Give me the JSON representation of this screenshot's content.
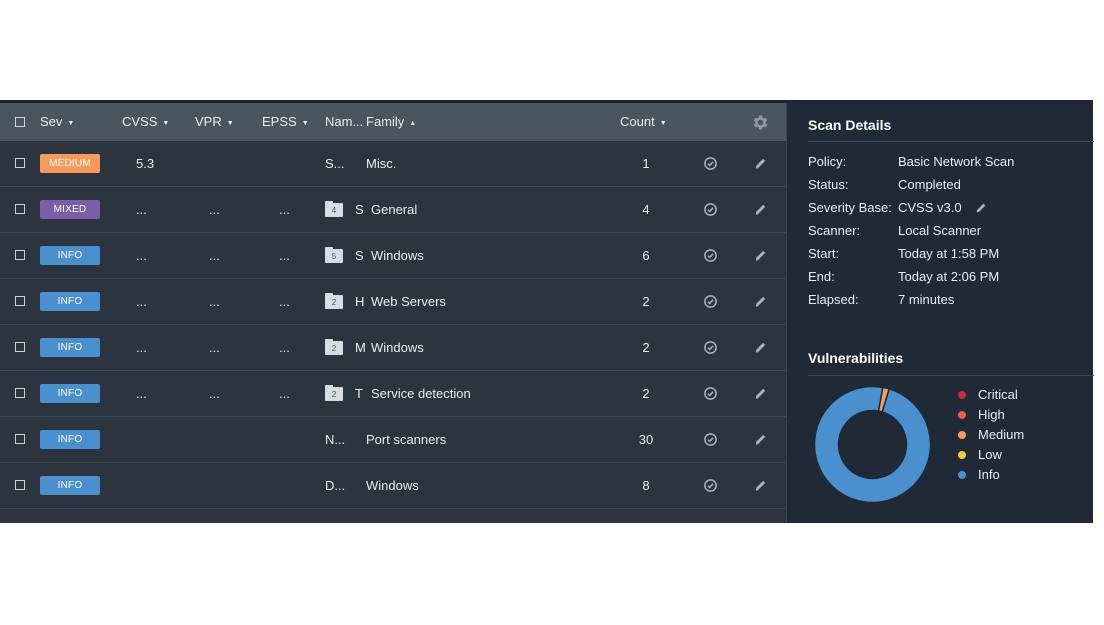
{
  "table": {
    "headers": {
      "sev": "Sev",
      "cvss": "CVSS",
      "vpr": "VPR",
      "epss": "EPSS",
      "name": "Nam...",
      "family": "Family",
      "count": "Count"
    },
    "sort_caret_down": "▼",
    "sort_caret_up": "▲",
    "rows": [
      {
        "severity": "MEDIUM",
        "cvss": "5.3",
        "vpr": "",
        "epss": "",
        "folder_count": "",
        "name": "S...",
        "family": "Misc.",
        "count": "1"
      },
      {
        "severity": "MIXED",
        "cvss": "...",
        "vpr": "...",
        "epss": "...",
        "folder_count": "4",
        "name": "S",
        "family": "General",
        "count": "4"
      },
      {
        "severity": "INFO",
        "cvss": "...",
        "vpr": "...",
        "epss": "...",
        "folder_count": "5",
        "name": "S",
        "family": "Windows",
        "count": "6"
      },
      {
        "severity": "INFO",
        "cvss": "...",
        "vpr": "...",
        "epss": "...",
        "folder_count": "2",
        "name": "H",
        "family": "Web Servers",
        "count": "2"
      },
      {
        "severity": "INFO",
        "cvss": "...",
        "vpr": "...",
        "epss": "...",
        "folder_count": "2",
        "name": "M",
        "family": "Windows",
        "count": "2"
      },
      {
        "severity": "INFO",
        "cvss": "...",
        "vpr": "...",
        "epss": "...",
        "folder_count": "2",
        "name": "T",
        "family": "Service detection",
        "count": "2"
      },
      {
        "severity": "INFO",
        "cvss": "",
        "vpr": "",
        "epss": "",
        "folder_count": "",
        "name": "N...",
        "family": "Port scanners",
        "count": "30"
      },
      {
        "severity": "INFO",
        "cvss": "",
        "vpr": "",
        "epss": "",
        "folder_count": "",
        "name": "D...",
        "family": "Windows",
        "count": "8"
      }
    ],
    "colors": {
      "MEDIUM": "#f79a5a",
      "MIXED": "#7b5ea7",
      "INFO": "#4a90cf"
    }
  },
  "details": {
    "title": "Scan Details",
    "fields": [
      {
        "label": "Policy:",
        "value": "Basic Network Scan"
      },
      {
        "label": "Status:",
        "value": "Completed"
      },
      {
        "label": "Severity Base:",
        "value": "CVSS v3.0"
      },
      {
        "label": "Scanner:",
        "value": "Local Scanner"
      },
      {
        "label": "Start:",
        "value": "Today at 1:58 PM"
      },
      {
        "label": "End:",
        "value": "Today at 2:06 PM"
      },
      {
        "label": "Elapsed:",
        "value": "7 minutes"
      }
    ]
  },
  "vulnerabilities": {
    "title": "Vulnerabilities",
    "legend": [
      {
        "label": "Critical",
        "color": "#d0283e"
      },
      {
        "label": "High",
        "color": "#ee5a4e"
      },
      {
        "label": "Medium",
        "color": "#f79a5a"
      },
      {
        "label": "Low",
        "color": "#f8c93e"
      },
      {
        "label": "Info",
        "color": "#4a90cf"
      }
    ],
    "chart_data": {
      "type": "pie",
      "categories": [
        "Critical",
        "High",
        "Medium",
        "Low",
        "Info"
      ],
      "values": [
        0,
        0,
        1,
        0,
        54
      ]
    }
  }
}
